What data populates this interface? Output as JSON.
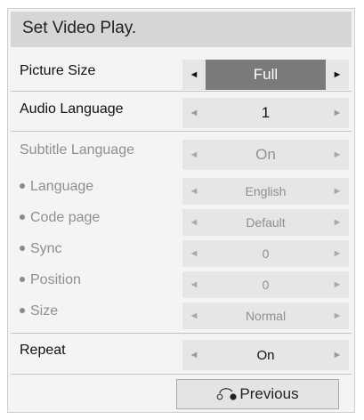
{
  "title": "Set Video Play.",
  "rows": [
    {
      "label": "Picture Size",
      "value": "Full"
    },
    {
      "label": "Audio Language",
      "value": "1"
    },
    {
      "label": "Subtitle Language",
      "value": "On"
    },
    {
      "label": "Language",
      "value": "English"
    },
    {
      "label": "Code page",
      "value": "Default"
    },
    {
      "label": "Sync",
      "value": "0"
    },
    {
      "label": "Position",
      "value": "0"
    },
    {
      "label": "Size",
      "value": "Normal"
    },
    {
      "label": "Repeat",
      "value": "On"
    }
  ],
  "previous_label": "Previous",
  "icons": {
    "left": "arrow-left-icon",
    "right": "arrow-right-icon",
    "back": "return-arrow-icon"
  },
  "colors": {
    "focused_value_bg": "#7a7a7a",
    "focused_value_text": "#ffffff",
    "disabled_text": "#8f8f8f"
  }
}
